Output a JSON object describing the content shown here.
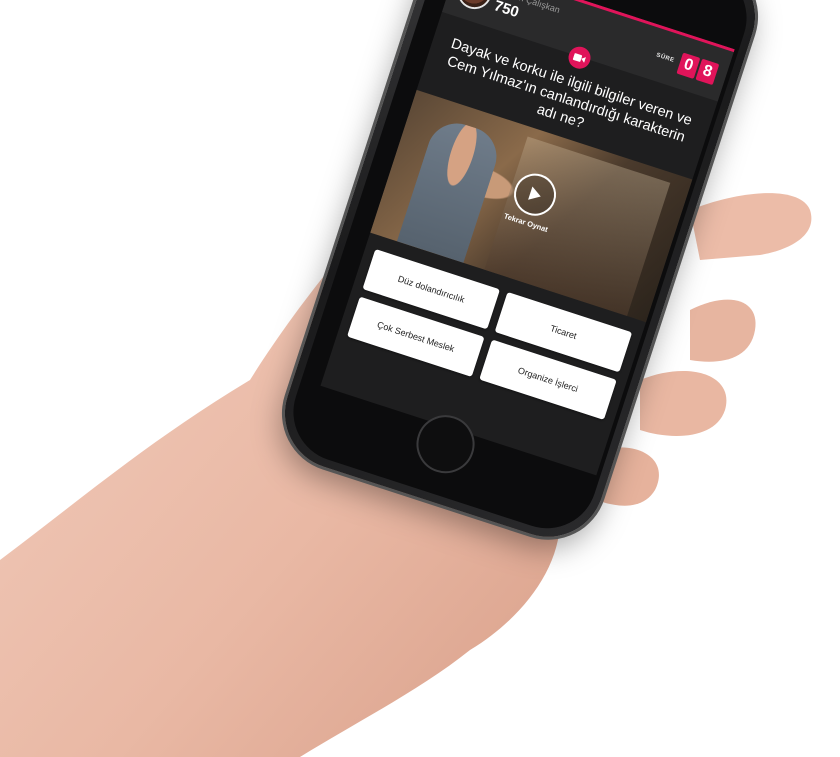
{
  "user": {
    "name": "Gizem Çalışkan",
    "score": "750"
  },
  "timer": {
    "label": "SÜRE",
    "digit1": "0",
    "digit2": "8"
  },
  "question": {
    "text": "Dayak ve korku ile ilgili bilgiler veren ve Cem Yılmaz'ın canlandırdığı karakterin adı ne?"
  },
  "media": {
    "replay_label": "Tekrar Oynat"
  },
  "answers": [
    {
      "label": "Düz dolandırıcılık"
    },
    {
      "label": "Ticaret"
    },
    {
      "label": "Çok Serbest Meslek"
    },
    {
      "label": "Organize İşlerci"
    }
  ],
  "colors": {
    "accent": "#e0145a",
    "screen_bg": "#1e1e1f",
    "topbar_bg": "#2a2a2b",
    "answer_bg": "#ffffff"
  },
  "icons": {
    "video": "video-camera-icon",
    "play": "play-icon"
  }
}
